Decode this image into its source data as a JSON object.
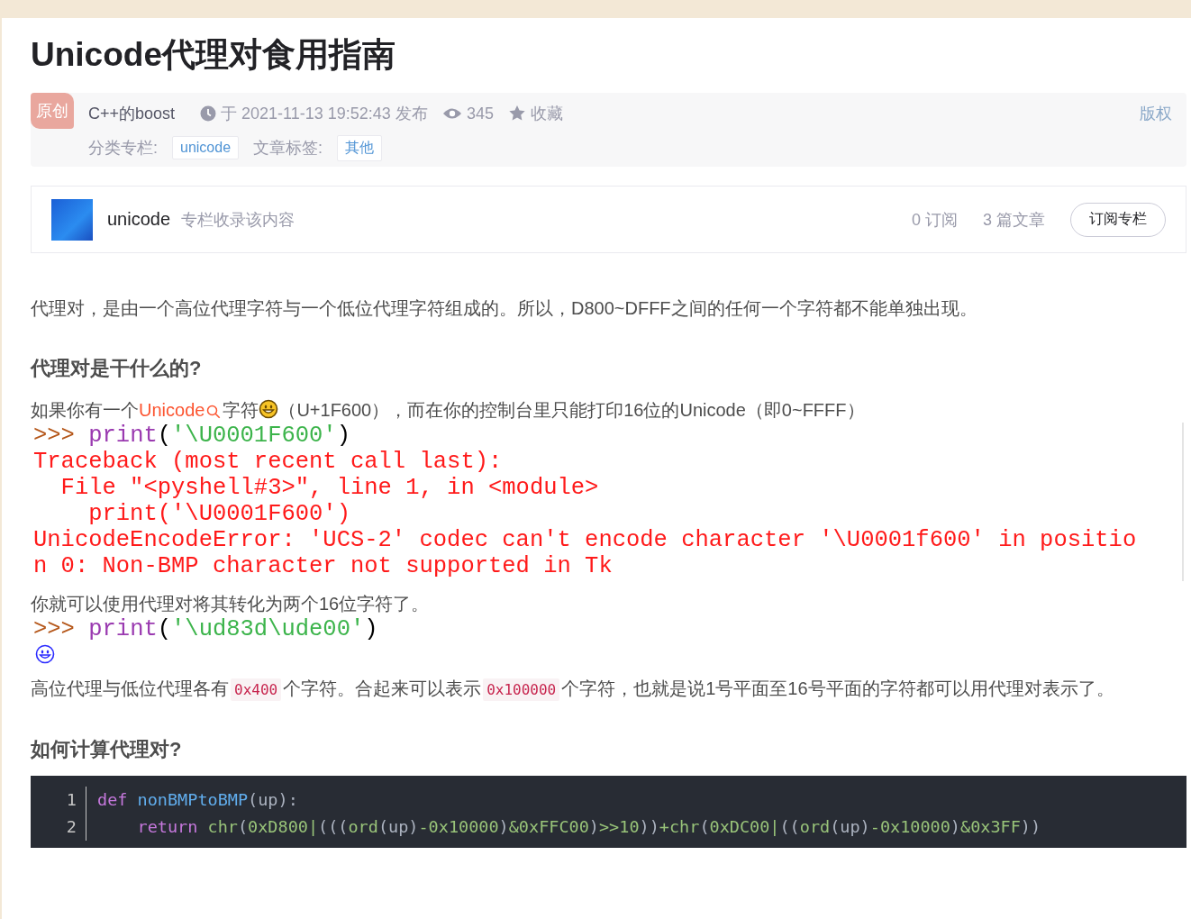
{
  "article": {
    "title": "Unicode代理对食用指南",
    "meta": {
      "badge": "原创",
      "author": "C++的boost",
      "published": "于 2021-11-13 19:52:43 发布",
      "views": "345",
      "collect": "收藏",
      "copyright": "版权",
      "category_label": "分类专栏:",
      "categories": [
        "unicode"
      ],
      "tag_label": "文章标签:",
      "tags": [
        "其他"
      ]
    },
    "column": {
      "name": "unicode",
      "note": "专栏收录该内容",
      "subscribers": "0 订阅",
      "articles": "3 篇文章",
      "button": "订阅专栏"
    },
    "blocks": [
      {
        "kind": "paragraph",
        "parts": [
          {
            "kind": "text",
            "text": "代理对，是由一个高位代理字符与一个低位代理字符组成的。所以，D800~DFFF之间的任何一个字符都不能单独出现。"
          }
        ]
      },
      {
        "kind": "heading",
        "text": "代理对是干什么的?"
      },
      {
        "kind": "paragraph",
        "parts": [
          {
            "kind": "text",
            "text": "如果你有一个"
          },
          {
            "kind": "link",
            "text": "Unicode"
          },
          {
            "kind": "search-mark"
          },
          {
            "kind": "text",
            "text": "字符"
          },
          {
            "kind": "emoji"
          },
          {
            "kind": "text",
            "text": "（U+1F600），而在你的控制台里只能打印16位的Unicode（即0~FFFF）"
          }
        ]
      },
      {
        "kind": "shell",
        "lines": [
          [
            {
              "kind": "prompt",
              "text": ">>> "
            },
            {
              "kind": "builtin",
              "text": "print"
            },
            {
              "kind": "plain",
              "text": "("
            },
            {
              "kind": "string",
              "text": "'\\U0001F600'"
            },
            {
              "kind": "plain",
              "text": ")"
            }
          ],
          [
            {
              "kind": "error",
              "text": "Traceback (most recent call last):"
            }
          ],
          [
            {
              "kind": "error",
              "text": "  File \"<pyshell#3>\", line 1, in <module>"
            }
          ],
          [
            {
              "kind": "error",
              "text": "    print('\\U0001F600')"
            }
          ],
          [
            {
              "kind": "error",
              "text": "UnicodeEncodeError: 'UCS-2' codec can't encode character '\\U0001f600' in positio"
            }
          ],
          [
            {
              "kind": "error",
              "text": "n 0: Non-BMP character not supported in Tk"
            }
          ]
        ],
        "bordered": true
      },
      {
        "kind": "paragraph",
        "parts": [
          {
            "kind": "text",
            "text": "你就可以使用代理对将其转化为两个16位字符了。"
          }
        ]
      },
      {
        "kind": "shell",
        "lines": [
          [
            {
              "kind": "prompt",
              "text": ">>> "
            },
            {
              "kind": "builtin",
              "text": "print"
            },
            {
              "kind": "plain",
              "text": "("
            },
            {
              "kind": "string",
              "text": "'\\ud83d\\ude00'"
            },
            {
              "kind": "plain",
              "text": ")"
            }
          ],
          [
            {
              "kind": "emoji-output"
            }
          ]
        ],
        "bordered": false
      },
      {
        "kind": "paragraph",
        "parts": [
          {
            "kind": "text",
            "text": "高位代理与低位代理各有"
          },
          {
            "kind": "code",
            "text": "0x400"
          },
          {
            "kind": "text",
            "text": "个字符。合起来可以表示"
          },
          {
            "kind": "code",
            "text": "0x100000"
          },
          {
            "kind": "text",
            "text": "个字符，也就是说1号平面至16号平面的字符都可以用代理对表示了。"
          }
        ]
      },
      {
        "kind": "heading",
        "text": "如何计算代理对?"
      },
      {
        "kind": "code",
        "lines": [
          {
            "number": "1",
            "tokens": [
              {
                "kind": "keyword",
                "text": "def"
              },
              {
                "kind": "func",
                "text": " nonBMPtoBMP"
              },
              {
                "kind": "plain",
                "text": "(up):"
              }
            ]
          },
          {
            "number": "2",
            "tokens": [
              {
                "kind": "keyword",
                "text": "    return"
              },
              {
                "kind": "builtin",
                "text": " chr"
              },
              {
                "kind": "plain",
                "text": "("
              },
              {
                "kind": "number",
                "text": "0xD800"
              },
              {
                "kind": "op",
                "text": "|"
              },
              {
                "kind": "plain",
                "text": "((("
              },
              {
                "kind": "builtin",
                "text": "ord"
              },
              {
                "kind": "plain",
                "text": "(up)"
              },
              {
                "kind": "number",
                "text": "-0x10000"
              },
              {
                "kind": "plain",
                "text": ")"
              },
              {
                "kind": "number",
                "text": "&0xFFC00"
              },
              {
                "kind": "plain",
                "text": ")"
              },
              {
                "kind": "number",
                "text": ">>10"
              },
              {
                "kind": "plain",
                "text": "))"
              },
              {
                "kind": "builtin",
                "text": "+chr"
              },
              {
                "kind": "plain",
                "text": "("
              },
              {
                "kind": "number",
                "text": "0xDC00"
              },
              {
                "kind": "op",
                "text": "|"
              },
              {
                "kind": "plain",
                "text": "(("
              },
              {
                "kind": "builtin",
                "text": "ord"
              },
              {
                "kind": "plain",
                "text": "(up)"
              },
              {
                "kind": "number",
                "text": "-0x10000"
              },
              {
                "kind": "plain",
                "text": ")"
              },
              {
                "kind": "number",
                "text": "&0x3FF"
              },
              {
                "kind": "plain",
                "text": "))"
              }
            ]
          }
        ]
      }
    ]
  }
}
